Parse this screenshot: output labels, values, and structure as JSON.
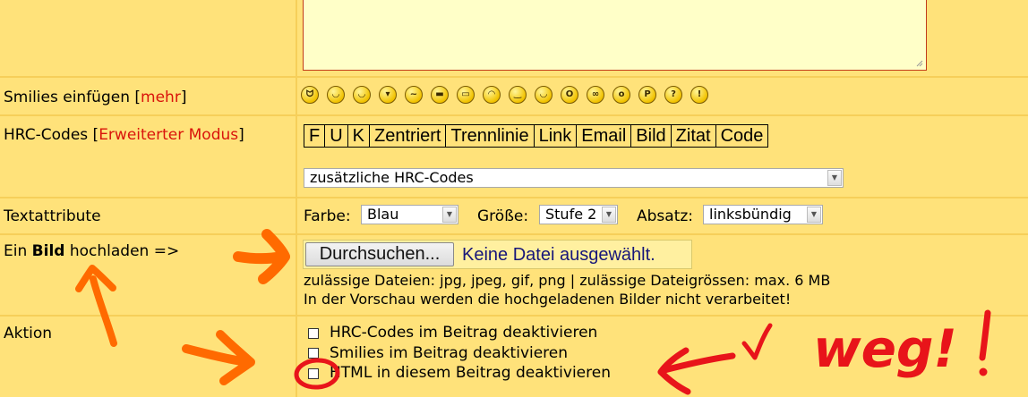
{
  "rows": {
    "smilies": {
      "label": "Smilies einfügen ",
      "bracket_open": "[",
      "link": "mehr",
      "bracket_close": "]"
    },
    "hrc": {
      "label": "HRC-Codes ",
      "bracket_open": "[",
      "link": "Erweiterter Modus",
      "bracket_close": "]"
    },
    "textattr": {
      "label": "Textattribute"
    },
    "upload": {
      "label_pre": "Ein ",
      "label_bold": "Bild",
      "label_post": " hochladen =>"
    },
    "aktion": {
      "label": "Aktion"
    }
  },
  "smilies": [
    {
      "name": "grin-smiley-icon",
      "glyph": "ᗢ"
    },
    {
      "name": "wink-smiley-icon",
      "glyph": "◡"
    },
    {
      "name": "smile-smiley-icon",
      "glyph": "◡"
    },
    {
      "name": "devil-smiley-icon",
      "glyph": "▾"
    },
    {
      "name": "confused-smiley-icon",
      "glyph": "~"
    },
    {
      "name": "cool-smiley-icon",
      "glyph": "▬"
    },
    {
      "name": "big-grin-smiley-icon",
      "glyph": "▭"
    },
    {
      "name": "sad-smiley-icon",
      "glyph": "◠"
    },
    {
      "name": "smirk-smiley-icon",
      "glyph": "‿"
    },
    {
      "name": "laugh-smiley-icon",
      "glyph": "◡"
    },
    {
      "name": "shocked-smiley-icon",
      "glyph": "O"
    },
    {
      "name": "crazy-smiley-icon",
      "glyph": "∞"
    },
    {
      "name": "cry-smiley-icon",
      "glyph": "o"
    },
    {
      "name": "tongue-smiley-icon",
      "glyph": "P"
    },
    {
      "name": "question-smiley-icon",
      "glyph": "?"
    },
    {
      "name": "exclamation-smiley-icon",
      "glyph": "!"
    }
  ],
  "hrc_buttons": [
    "F",
    "U",
    "K",
    "Zentriert",
    "Trennlinie",
    "Link",
    "Email",
    "Bild",
    "Zitat",
    "Code"
  ],
  "hrc_select": {
    "value": "zusätzliche HRC-Codes"
  },
  "textattr": {
    "farbe_label": "Farbe:",
    "farbe_value": "Blau",
    "groesse_label": "Größe:",
    "groesse_value": "Stufe 2",
    "absatz_label": "Absatz:",
    "absatz_value": "linksbündig"
  },
  "upload": {
    "button": "Durchsuchen...",
    "status": "Keine Datei ausgewählt.",
    "info1": "zulässige Dateien: jpg, jpeg, gif, png | zulässige Dateigrössen: max. 6 MB",
    "info2": "In der Vorschau werden die hochgeladenen Bilder nicht verarbeitet!"
  },
  "aktion": [
    "HRC-Codes im Beitrag deaktivieren",
    "Smilies im Beitrag deaktivieren",
    "HTML in diesem Beitrag deaktivieren"
  ],
  "annotations": {
    "text": "weg!"
  },
  "colors": {
    "background": "#ffe27a",
    "link_red": "#d9140b",
    "annotation_orange": "#ff6a00",
    "annotation_red": "#e8141a"
  }
}
